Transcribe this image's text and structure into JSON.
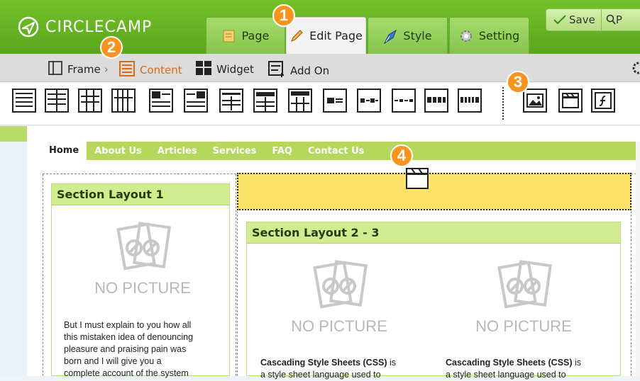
{
  "app": {
    "logo_text": "CIRCLECAMP"
  },
  "tabs": [
    {
      "label": "Page"
    },
    {
      "label": "Edit Page"
    },
    {
      "label": "Style"
    },
    {
      "label": "Setting"
    }
  ],
  "toolbar": {
    "save_label": "Save",
    "preview_label": "P"
  },
  "subbar": {
    "frame_label": "Frame",
    "content_label": "Content",
    "widget_label": "Widget",
    "addon_label": "Add On"
  },
  "badges": [
    "1",
    "2",
    "3",
    "4"
  ],
  "site_nav": [
    "Home",
    "About Us",
    "Articles",
    "Services",
    "FAQ",
    "Contact Us"
  ],
  "section1": {
    "title": "Section Layout 1",
    "no_picture": "NO PICTURE",
    "text": [
      "But I must explain to you how all",
      "this mistaken idea of denouncing",
      "pleasure and praising pain was",
      "born and I will give you a",
      "complete account of the system"
    ]
  },
  "section2": {
    "title": "Section Layout 2 - 3",
    "col1": {
      "no_picture": "NO PICTURE",
      "bold": "Cascading Style Sheets (CSS)",
      "rest": " is",
      "line2": "a style sheet language used to"
    },
    "col2": {
      "no_picture": "NO PICTURE",
      "bold": "Cascading Style Sheets (CSS)",
      "rest": " is",
      "line2": "a style sheet language used to"
    }
  },
  "colors": {
    "brand_green": "#6ab826",
    "badge_orange": "#f7931e",
    "content_orange": "#e06a10",
    "drop_yellow": "#fde36a"
  }
}
